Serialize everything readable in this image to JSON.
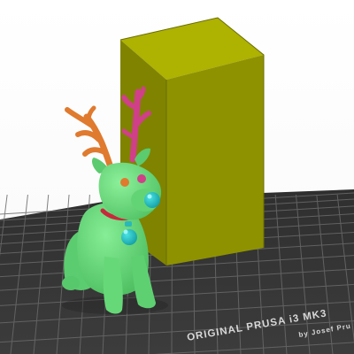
{
  "viewport": {
    "printer_bed": {
      "brand_line": "ORIGINAL PRUSA i3 MK3",
      "maker_line": "by Josef Pru",
      "surface_color": "#3a3a3a",
      "grid_color": "#6a6a6a"
    },
    "objects": [
      {
        "id": "reindeer-model",
        "body_color": "#6fdc80",
        "antler_left_color": "#e07a2e",
        "antler_right_color": "#d04088",
        "nose_color": "#28c4c4",
        "collar_color": "#c8283c"
      },
      {
        "id": "wipe-tower-block",
        "color": "#8e9200"
      }
    ]
  }
}
